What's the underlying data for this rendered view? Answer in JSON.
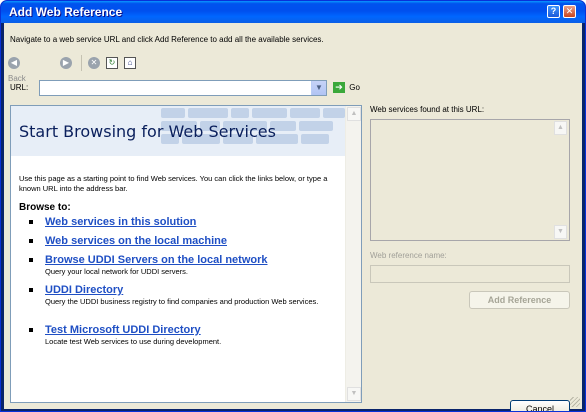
{
  "window": {
    "title": "Add Web Reference",
    "help_glyph": "?",
    "close_glyph": "✕"
  },
  "instructions": "Navigate to a web service URL and click Add Reference to add all the available services.",
  "toolbar": {
    "back_label": "Back",
    "back_icon": "back-arrow-icon",
    "forward_icon": "forward-arrow-icon",
    "stop_icon": "stop-icon",
    "refresh_icon": "refresh-icon",
    "home_icon": "home-icon"
  },
  "url": {
    "label": "URL:",
    "value": "",
    "placeholder": "",
    "go_label": "Go"
  },
  "browser": {
    "title": "Start Browsing for Web Services",
    "intro": "Use this page as a starting point to find Web services. You can click the links below, or type a known URL into the address bar.",
    "browse_to": "Browse to:",
    "links": [
      {
        "label": "Web services in this solution",
        "desc": ""
      },
      {
        "label": "Web services on the local machine",
        "desc": ""
      },
      {
        "label": "Browse UDDI Servers on the local network",
        "desc": "Query your local network for UDDI servers."
      },
      {
        "label": "UDDI Directory",
        "desc": "Query the UDDI business registry to find companies and production Web services."
      },
      {
        "label": "Test Microsoft UDDI Directory",
        "desc": "Locate test Web services to use during development."
      }
    ]
  },
  "right_panel": {
    "found_label": "Web services found at this URL:",
    "refname_label": "Web reference name:",
    "refname_value": "",
    "add_reference_label": "Add Reference",
    "cancel_label": "Cancel"
  },
  "colors": {
    "title_bar": "#0053ee",
    "link": "#1f4fc4",
    "dialog_bg": "#ece9d8",
    "hero_bg": "#e7eef7"
  }
}
